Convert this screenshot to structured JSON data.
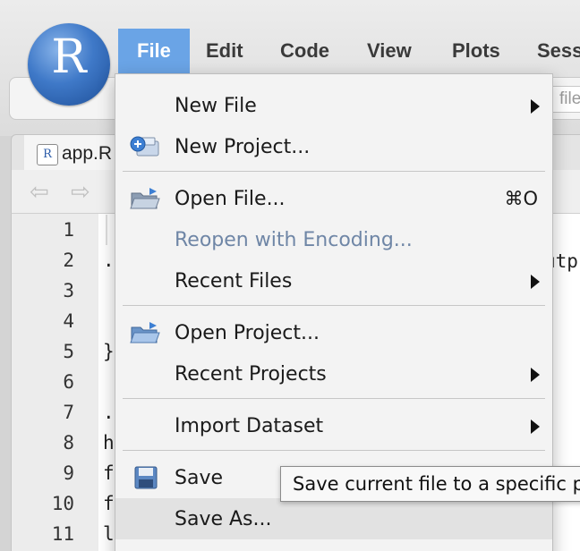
{
  "app": {
    "logo_letter": "R"
  },
  "menubar": {
    "items": [
      {
        "label": "File"
      },
      {
        "label": "Edit"
      },
      {
        "label": "Code"
      },
      {
        "label": "View"
      },
      {
        "label": "Plots"
      },
      {
        "label": "Sess"
      }
    ],
    "search_partial": "file"
  },
  "editor": {
    "tab_label": "app.R",
    "line_numbers": [
      "1",
      "2",
      "3",
      "4",
      "5",
      "6",
      "7",
      "8",
      "9",
      "10",
      "11"
    ],
    "visible_code": {
      "line2": ".",
      "line5": "}",
      "line7": ".",
      "line8": "h",
      "line9": "f",
      "line10": "f",
      "line11": "l",
      "line2_right": "utp"
    }
  },
  "file_menu": {
    "items": [
      {
        "label": "New File",
        "submenu": true
      },
      {
        "label": "New Project...",
        "icon": "new-project-icon"
      },
      {
        "label": "Open File...",
        "shortcut": "⌘O",
        "icon": "open-folder-icon"
      },
      {
        "label": "Reopen with Encoding...",
        "disabled": true
      },
      {
        "label": "Recent Files",
        "submenu": true
      },
      {
        "label": "Open Project...",
        "icon": "open-project-icon"
      },
      {
        "label": "Recent Projects",
        "submenu": true
      },
      {
        "label": "Import Dataset",
        "submenu": true
      },
      {
        "label": "Save",
        "icon": "save-icon"
      },
      {
        "label": "Save As...",
        "highlighted": true
      }
    ]
  },
  "tooltip": {
    "text": "Save current file to a specific p"
  },
  "colors": {
    "menu_active": "#6aa4e6",
    "disabled_text": "#6f86a6",
    "menu_bg": "#f3f3f3"
  }
}
